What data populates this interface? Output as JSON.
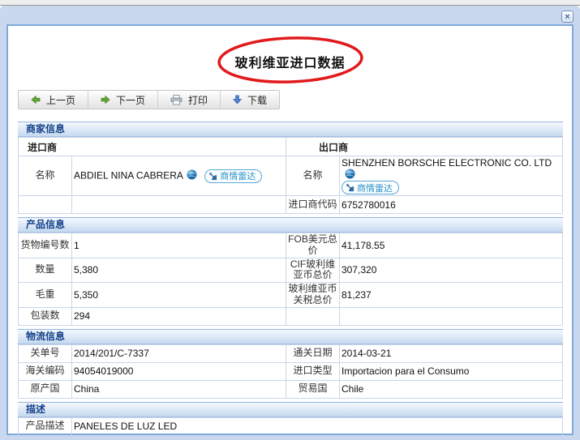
{
  "window": {
    "close_label": "×"
  },
  "title": "玻利维亚进口数据",
  "toolbar": {
    "prev_label": "上一页",
    "next_label": "下一页",
    "print_label": "打印",
    "download_label": "下载"
  },
  "sections": {
    "merchant": {
      "header": "商家信息",
      "importer_header": "进口商",
      "exporter_header": "出口商",
      "name_label": "名称",
      "importer_name": "ABDIEL NINA CABRERA",
      "exporter_name": "SHENZHEN BORSCHE ELECTRONIC CO. LTD",
      "radar_badge": "商情雷达",
      "importer_code_label": "进口商代码",
      "importer_code": "6752780016"
    },
    "product": {
      "header": "产品信息",
      "rows": [
        {
          "l1": "货物编号数",
          "v1": "1",
          "l2": "FOB美元总价",
          "v2": "41,178.55"
        },
        {
          "l1": "数量",
          "v1": "5,380",
          "l2": "CIF玻利维亚币总价",
          "v2": "307,320"
        },
        {
          "l1": "毛重",
          "v1": "5,350",
          "l2": "玻利维亚币关税总价",
          "v2": "81,237"
        },
        {
          "l1": "包装数",
          "v1": "294",
          "l2": "",
          "v2": ""
        }
      ]
    },
    "logistics": {
      "header": "物流信息",
      "rows": [
        {
          "l1": "关单号",
          "v1": "2014/201/C-7337",
          "l2": "通关日期",
          "v2": "2014-03-21"
        },
        {
          "l1": "海关编码",
          "v1": "94054019000",
          "l2": "进口类型",
          "v2": "Importacion para el Consumo"
        },
        {
          "l1": "原产国",
          "v1": "China",
          "l2": "贸易国",
          "v2": "Chile"
        }
      ]
    },
    "description": {
      "header": "描述",
      "label": "产品描述",
      "value": "PANELES DE LUZ LED"
    }
  },
  "colors": {
    "annotation_red": "#e2191c",
    "section_header_text": "#15428b",
    "badge_blue": "#2992c8",
    "panel_border": "#7ea9dc"
  }
}
